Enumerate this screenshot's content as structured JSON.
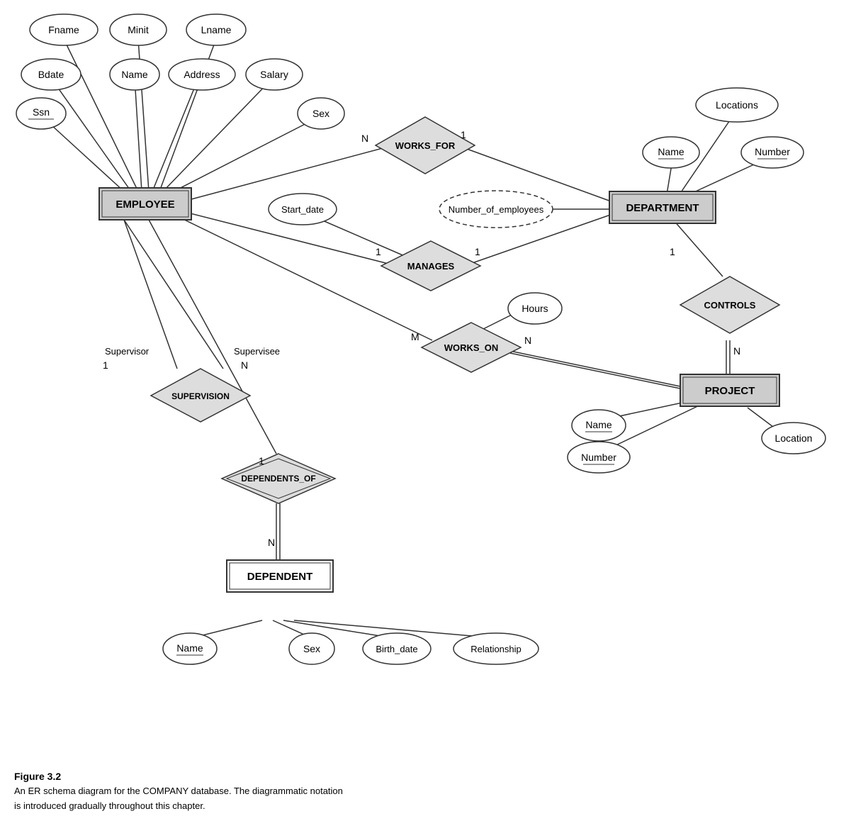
{
  "caption": {
    "title": "Figure 3.2",
    "line1": "An ER schema diagram for the COMPANY database. The diagrammatic notation",
    "line2": "is introduced gradually throughout this chapter."
  },
  "entities": {
    "employee": "EMPLOYEE",
    "department": "DEPARTMENT",
    "project": "PROJECT",
    "dependent": "DEPENDENT"
  },
  "relationships": {
    "works_for": "WORKS_FOR",
    "manages": "MANAGES",
    "works_on": "WORKS_ON",
    "controls": "CONTROLS",
    "supervision": "SUPERVISION",
    "dependents_of": "DEPENDENTS_OF"
  },
  "attributes": {
    "fname": "Fname",
    "minit": "Minit",
    "lname": "Lname",
    "bdate": "Bdate",
    "name_emp": "Name",
    "address": "Address",
    "salary": "Salary",
    "ssn": "Ssn",
    "sex_emp": "Sex",
    "start_date": "Start_date",
    "number_of_employees": "Number_of_employees",
    "locations": "Locations",
    "dept_name": "Name",
    "dept_number": "Number",
    "hours": "Hours",
    "proj_name": "Name",
    "proj_number": "Number",
    "location": "Location",
    "dep_name": "Name",
    "dep_sex": "Sex",
    "birth_date": "Birth_date",
    "relationship": "Relationship"
  },
  "cardinalities": {
    "n1": "N",
    "one1": "1",
    "one2": "1",
    "n2": "N",
    "m": "M",
    "n3": "N",
    "one3": "1",
    "n4": "N",
    "supervisor": "Supervisor",
    "one4": "1",
    "supervisee": "Supervisee",
    "n5": "N",
    "one5": "1",
    "n6": "N"
  }
}
